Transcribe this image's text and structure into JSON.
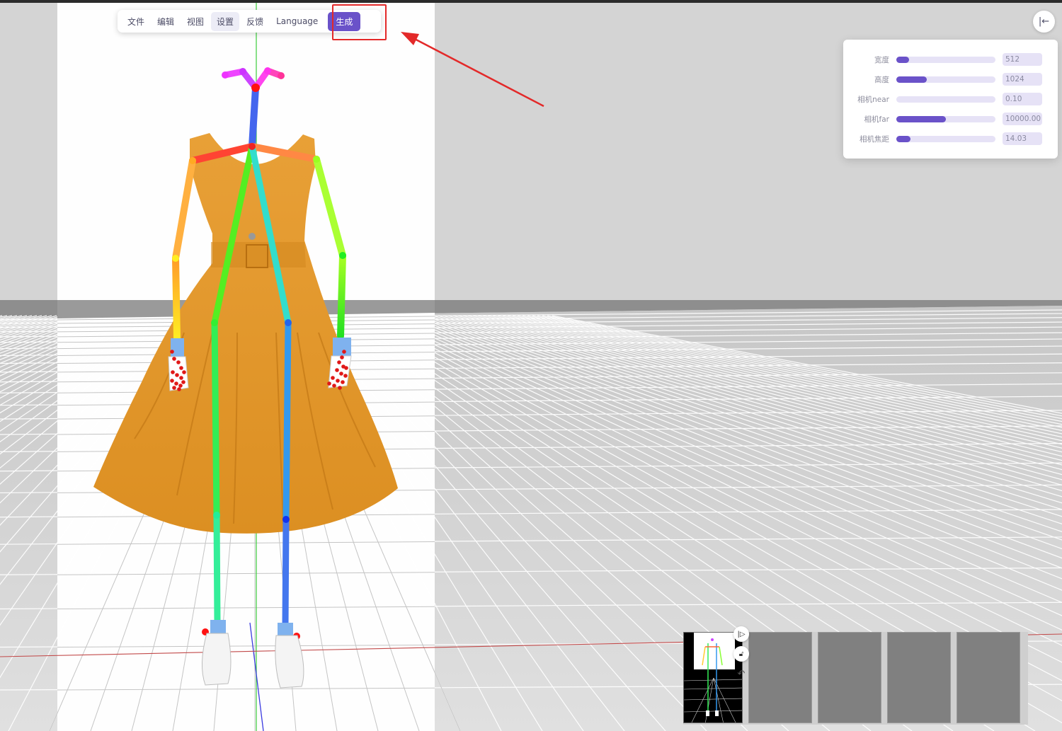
{
  "menu": {
    "items": [
      {
        "label": "文件"
      },
      {
        "label": "编辑"
      },
      {
        "label": "视图"
      },
      {
        "label": "设置"
      },
      {
        "label": "反馈"
      },
      {
        "label": "Language"
      }
    ],
    "generate_label": "生成"
  },
  "settings": {
    "rows": [
      {
        "label": "宽度",
        "value": "512",
        "fill": 0.13
      },
      {
        "label": "高度",
        "value": "1024",
        "fill": 0.31
      },
      {
        "label": "相机near",
        "value": "0.10",
        "fill": 0.0
      },
      {
        "label": "相机far",
        "value": "10000.00",
        "fill": 0.5
      },
      {
        "label": "相机焦距",
        "value": "14.03",
        "fill": 0.14
      }
    ]
  },
  "icons": {
    "collapse": "collapse-panel-icon",
    "play": "play-icon",
    "lock": "unlock-icon",
    "reset": "undo-icon"
  },
  "colors": {
    "accent": "#6a52c9",
    "highlight": "#e32929",
    "dress": "#e89a2e"
  }
}
